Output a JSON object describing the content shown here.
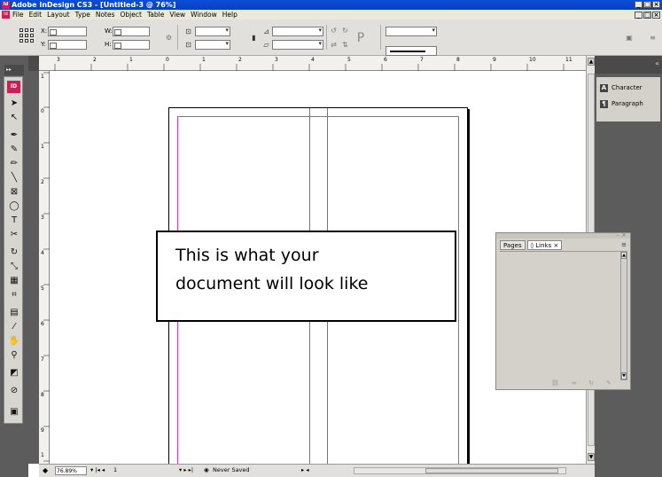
{
  "window": {
    "title": "Adobe InDesign CS3 - [Untitled-3 @ 76%]",
    "app_icon": "Id",
    "controls": [
      "_",
      "□",
      "×"
    ]
  },
  "menu": {
    "items": [
      "File",
      "Edit",
      "Layout",
      "Type",
      "Notes",
      "Object",
      "Table",
      "View",
      "Window",
      "Help"
    ]
  },
  "control_bar": {
    "x_label": "X:",
    "y_label": "Y:",
    "w_label": "W:",
    "h_label": "H:"
  },
  "toolbox": {
    "logo": "ID",
    "tools": [
      "selection-tool",
      "direct-selection-tool",
      "pen-tool",
      "add-anchor-tool",
      "pencil-tool",
      "line-tool",
      "rectangle-frame-tool",
      "ellipse-tool",
      "type-tool",
      "scissors-tool",
      "rotate-tool",
      "scale-tool",
      "gradient-tool",
      "free-transform-tool",
      "note-tool",
      "eyedropper-tool",
      "hand-tool",
      "zoom-tool",
      "fill-stroke-swatch",
      "apply-none",
      "preview-mode"
    ]
  },
  "ruler": {
    "h_labels": [
      "3",
      "2",
      "1",
      "0",
      "1",
      "2",
      "3",
      "4",
      "5",
      "6",
      "7",
      "8",
      "9",
      "10",
      "11"
    ],
    "v_labels": [
      "1",
      "0",
      "1",
      "2",
      "3",
      "4",
      "5",
      "6",
      "7",
      "8",
      "9",
      "1"
    ]
  },
  "callout": {
    "line1": "This is what your",
    "line2": "document will look like"
  },
  "right_dock": {
    "buttons": [
      {
        "label": "Character",
        "icon": "A"
      },
      {
        "label": "Paragraph",
        "icon": "¶"
      }
    ]
  },
  "floating_panel": {
    "tabs": [
      "Pages",
      "◊ Links ×"
    ],
    "active_tab": 1
  },
  "status": {
    "zoom": "76.89%",
    "page": "1",
    "preflight": "Never Saved"
  },
  "colors": {
    "title_bar": "#0a4fd8",
    "margin_guide": "#d838d8",
    "column_guide": "#a04cd8",
    "dock": "#5c5c5c"
  }
}
